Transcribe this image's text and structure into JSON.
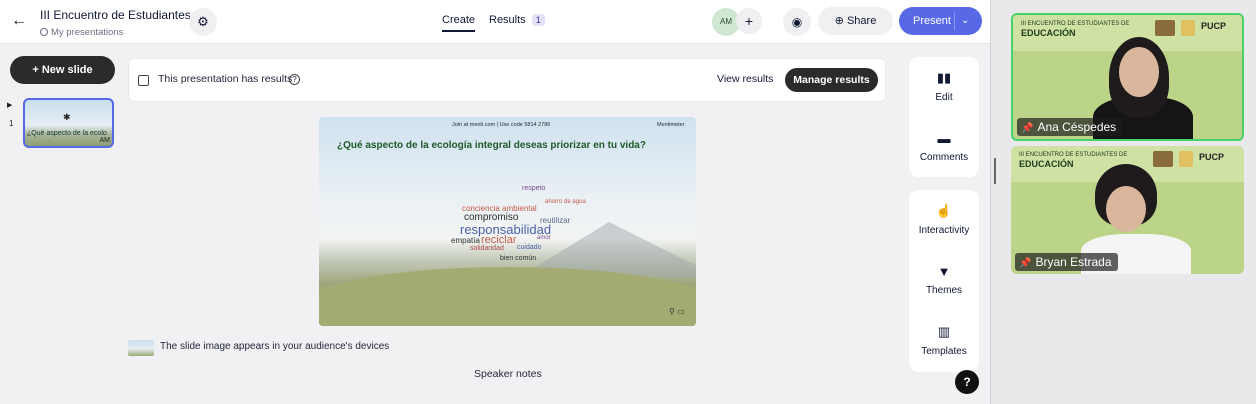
{
  "header": {
    "title": "III Encuentro de Estudiantes",
    "breadcrumb": "My presentations",
    "tabs": [
      {
        "label": "Create"
      },
      {
        "label": "Results",
        "badge": "1"
      }
    ],
    "avatar": "AM",
    "add_icon": "+",
    "share_label": "Share",
    "present_label": "Present"
  },
  "sidebar": {
    "new_slide_label": "+ New slide",
    "slides": [
      {
        "number": "1",
        "title": "¿Qué aspecto de la ecolo",
        "avatar": "AM"
      }
    ]
  },
  "banner": {
    "text": "This presentation has results",
    "view_results": "View results",
    "manage_results": "Manage results"
  },
  "slide": {
    "join_text": "Join at menti.com | Use code  5814 2786",
    "logo_text": "Mentimeter",
    "question": "¿Qué aspecto de la ecología integral deseas priorizar en tu vida?",
    "words": [
      {
        "text": "responsabilidad",
        "color": "#4a5ea8"
      },
      {
        "text": "compromiso",
        "color": "#2b2b2b"
      },
      {
        "text": "reciclar",
        "color": "#c75a4a"
      },
      {
        "text": "empatía",
        "color": "#333333"
      },
      {
        "text": "solidaridad",
        "color": "#a84848"
      },
      {
        "text": "bien común",
        "color": "#333333"
      },
      {
        "text": "reutilizar",
        "color": "#5a6a8a"
      },
      {
        "text": "conciencia ambiental",
        "color": "#c75a4a"
      },
      {
        "text": "respeto",
        "color": "#7a4a8a"
      },
      {
        "text": "cuidado",
        "color": "#4a5ea8"
      },
      {
        "text": "amor",
        "color": "#7a4a8a"
      },
      {
        "text": "ahorro de agua",
        "color": "#c75a4a"
      }
    ]
  },
  "slide_footer": {
    "audience_text": "The slide image appears in your audience's devices",
    "speaker_notes": "Speaker notes"
  },
  "right_panel": {
    "items": [
      {
        "label": "Edit",
        "icon": "edit-icon"
      },
      {
        "label": "Comments",
        "icon": "comments-icon"
      },
      {
        "label": "Interactivity",
        "icon": "interactivity-icon"
      },
      {
        "label": "Themes",
        "icon": "themes-icon"
      },
      {
        "label": "Templates",
        "icon": "templates-icon"
      }
    ],
    "help": "?"
  },
  "video": {
    "participants": [
      {
        "name": "Ana Céspedes"
      },
      {
        "name": "Bryan Estrada"
      }
    ],
    "banner_title": "EDUCACIÓN",
    "banner_sub": "III ENCUENTRO DE ESTUDIANTES DE",
    "pucp": "PUCP"
  }
}
